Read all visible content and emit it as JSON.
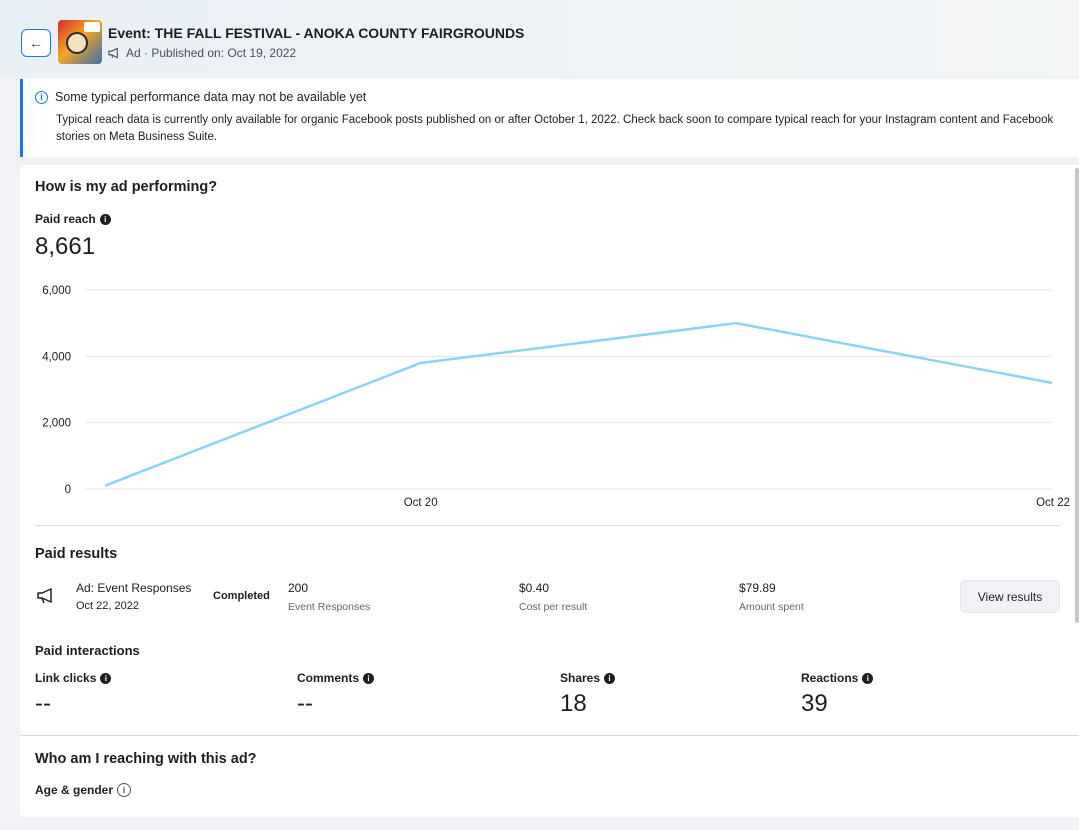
{
  "header": {
    "event_title": "Event: THE FALL FESTIVAL - ANOKA COUNTY FAIRGROUNDS",
    "subtitle": "Ad · Published on: Oct 19, 2022"
  },
  "notice": {
    "title": "Some typical performance data may not be available yet",
    "body": "Typical reach data is currently only available for organic Facebook posts published on or after October 1, 2022. Check back soon to compare typical reach for your Instagram content and Facebook stories on Meta Business Suite."
  },
  "performance": {
    "title": "How is my ad performing?",
    "metric_label": "Paid reach",
    "metric_value": "8,661"
  },
  "chart_data": {
    "type": "line",
    "x": [
      "Oct 19",
      "Oct 20",
      "Oct 21",
      "Oct 22"
    ],
    "x_tick_labels": [
      "Oct 20",
      "Oct 22"
    ],
    "y": [
      100,
      3800,
      5000,
      3200
    ],
    "ylim": [
      0,
      6000
    ],
    "y_ticks": [
      "0",
      "2,000",
      "4,000",
      "6,000"
    ],
    "grid": true,
    "line_color": "#8fd3f4"
  },
  "paid_results": {
    "title": "Paid results",
    "ad_name": "Ad: Event Responses",
    "ad_date": "Oct 22, 2022",
    "status": "Completed",
    "results_value": "200",
    "results_label": "Event Responses",
    "cost_value": "$0.40",
    "cost_label": "Cost per result",
    "spent_value": "$79.89",
    "spent_label": "Amount spent",
    "view_button": "View results"
  },
  "interactions": {
    "title": "Paid interactions",
    "items": [
      {
        "label": "Link clicks",
        "value": "--"
      },
      {
        "label": "Comments",
        "value": "--"
      },
      {
        "label": "Shares",
        "value": "18"
      },
      {
        "label": "Reactions",
        "value": "39"
      }
    ]
  },
  "audience": {
    "title": "Who am I reaching with this ad?",
    "age_gender_label": "Age & gender"
  },
  "icons": {
    "back": "arrow-left-icon",
    "megaphone": "megaphone-icon",
    "info": "info-icon"
  }
}
